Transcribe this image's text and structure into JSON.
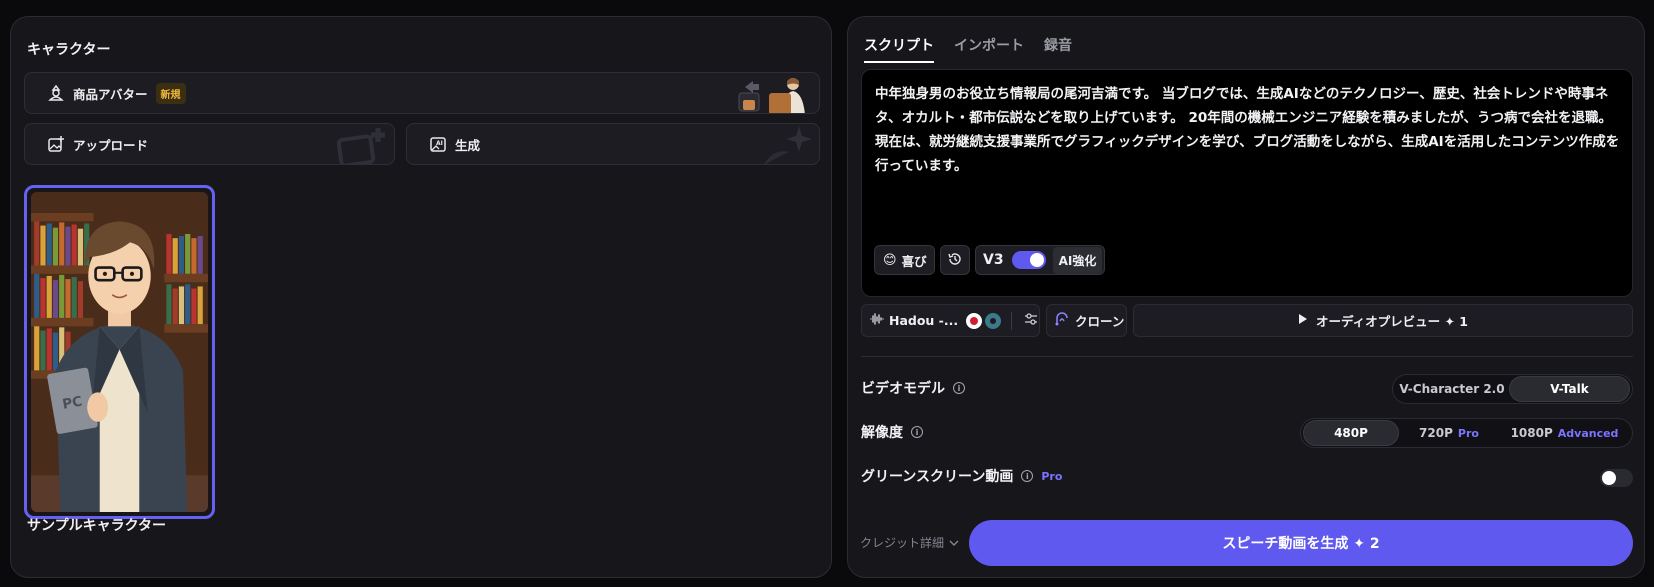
{
  "left": {
    "character_title": "キャラクター",
    "product_avatar_label": "商品アバター",
    "new_badge": "新規",
    "upload_label": "アップロード",
    "generate_label": "生成",
    "sample_title": "サンプルキャラクター"
  },
  "right": {
    "tabs": [
      "スクリプト",
      "インポート",
      "録音"
    ],
    "script_text": "中年独身男のお役立ち情報局の尾河吉満です。 当ブログでは、生成AIなどのテクノロジー、歴史、社会トレンドや時事ネタ、オカルト・都市伝説などを取り上げています。 20年間の機械エンジニア経験を積みましたが、うつ病で会社を退職。現在は、就労継続支援事業所でグラフィックデザインを学び、ブログ活動をしながら、生成AIを活用したコンテンツ作成を行っています。",
    "emotion_emoji": "😊",
    "emotion_label": "喜び",
    "version_label": "V3",
    "version_toggle_on": true,
    "ai_enhance_label": "AI強化",
    "voice_name": "Hadou -...",
    "clone_label": "クローン",
    "audio_preview_label": "オーディオプレビュー ✦ 1",
    "video_model_label": "ビデオモデル",
    "video_model_options": [
      "V-Character 2.0",
      "V-Talk"
    ],
    "video_model_selected": "V-Talk",
    "resolution_label": "解像度",
    "resolution_options": [
      {
        "label": "480P",
        "tag": ""
      },
      {
        "label": "720P",
        "tag": "Pro"
      },
      {
        "label": "1080P",
        "tag": "Advanced"
      }
    ],
    "resolution_selected": "480P",
    "green_screen_label": "グリーンスクリーン動画",
    "green_screen_tag": "Pro",
    "green_screen_on": false,
    "credit_label": "クレジット詳細",
    "generate_button": "スピーチ動画を生成 ✦ 2"
  },
  "colors": {
    "accent": "#6059f0",
    "pro_tag": "#7c74ff",
    "new_badge": "#f0b93a"
  }
}
